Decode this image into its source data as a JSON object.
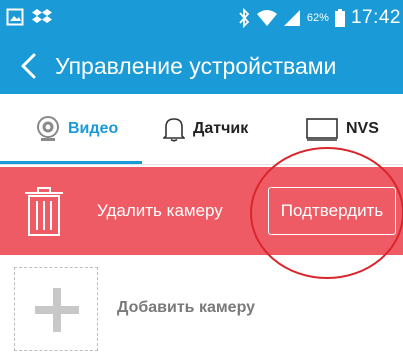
{
  "status_bar": {
    "left_icons": [
      "image-icon",
      "dropbox-icon"
    ],
    "right_icons": [
      "bluetooth-icon",
      "wifi-icon",
      "signal-icon",
      "battery-icon"
    ],
    "battery_percent": "62%",
    "time": "17:42"
  },
  "app_bar": {
    "title": "Управление устройствами",
    "back_icon": "chevron-left-icon"
  },
  "tabs": [
    {
      "label": "Видео",
      "icon": "webcam-icon",
      "active": true
    },
    {
      "label": "Датчик",
      "icon": "bell-icon",
      "active": false
    },
    {
      "label": "NVS",
      "icon": "monitor-icon",
      "active": false
    }
  ],
  "delete_bar": {
    "label": "Удалить камеру",
    "confirm_label": "Подтвердить",
    "icon": "trash-icon"
  },
  "add_camera": {
    "label": "Добавить камеру",
    "icon": "plus-icon"
  },
  "colors": {
    "accent": "#1a9ad6",
    "delete_bar": "#ef5b64",
    "annotation_circle": "#d9262c"
  }
}
